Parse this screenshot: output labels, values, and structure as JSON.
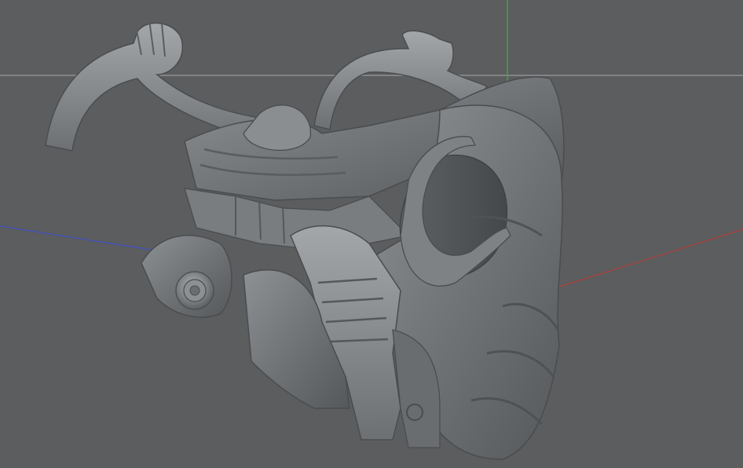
{
  "viewport": {
    "background_color": "#5b5d5e",
    "grid_line_color": "#8e9092",
    "axis_x_color": "#b0413d",
    "axis_y_color": "#3fae43",
    "axis_z_color": "#4550c4",
    "model_base_color": "#717477",
    "model_highlight_color": "#9a9ea1",
    "model_shadow_color": "#4a4d50"
  }
}
